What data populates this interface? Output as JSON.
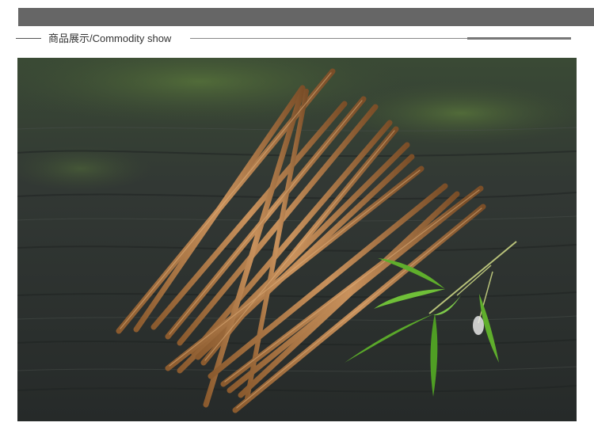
{
  "header": {
    "title": "商品展示/Commodity show"
  },
  "photo": {
    "subject": "wooden-chopsticks-on-mossy-plank",
    "colors": {
      "wood_dark": "#2f3331",
      "wood_mid": "#3f4542",
      "moss": "#4f6a3a",
      "chopstick_light": "#c08a57",
      "chopstick_dark": "#7a4e28",
      "leaf": "#5fae2c"
    }
  }
}
